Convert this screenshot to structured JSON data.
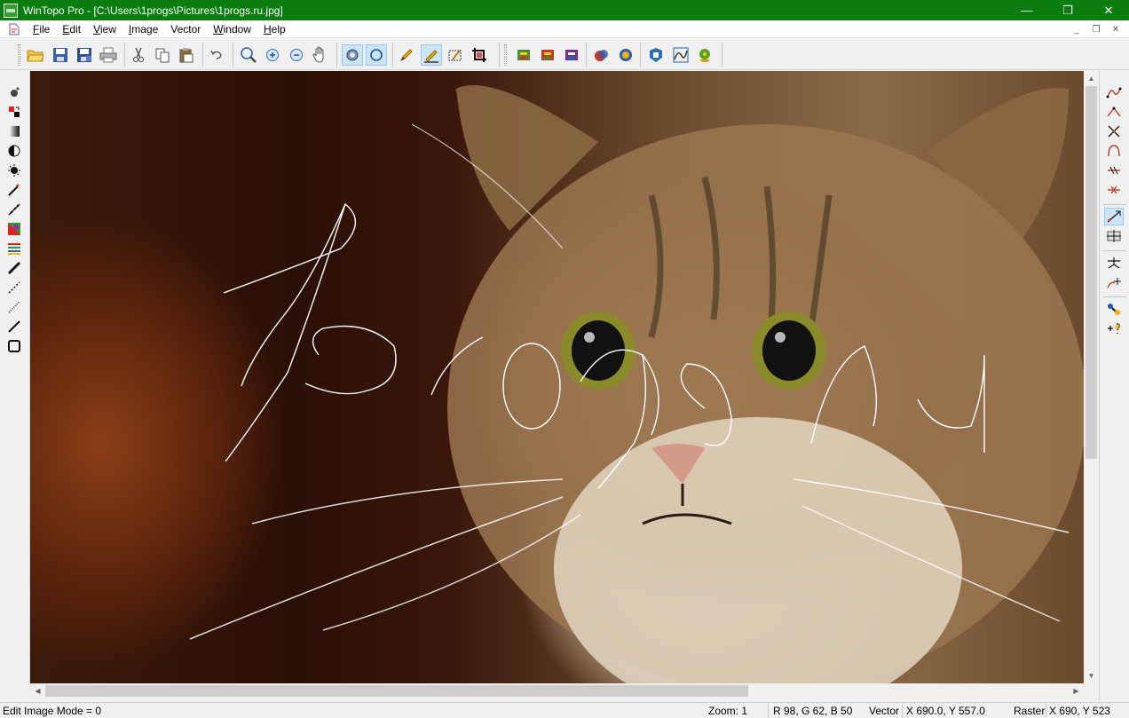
{
  "window": {
    "title": "WinTopo Pro - [C:\\Users\\1progs\\Pictures\\1progs.ru.jpg]",
    "minimize": "—",
    "restore": "❐",
    "close": "✕"
  },
  "menu": {
    "items": [
      {
        "accel": "F",
        "rest": "ile"
      },
      {
        "accel": "E",
        "rest": "dit"
      },
      {
        "accel": "V",
        "rest": "iew"
      },
      {
        "accel": "I",
        "rest": "mage"
      },
      {
        "accel": "",
        "rest": "Vector",
        "accel_after": "V",
        "label": "Vector"
      },
      {
        "accel": "W",
        "rest": "indow"
      },
      {
        "accel": "H",
        "rest": "elp"
      }
    ],
    "mdi_minimize": "_",
    "mdi_restore": "❐",
    "mdi_close": "✕"
  },
  "toolbar": {
    "icons": [
      "open-icon",
      "save-icon",
      "save-as-icon",
      "print-icon",
      "cut-icon",
      "copy-icon",
      "paste-icon",
      "undo-icon",
      "zoom-icon",
      "zoom-in-icon",
      "zoom-out-icon",
      "pan-hand-icon",
      "raster-view-icon",
      "vector-view-icon",
      "pencil-icon",
      "trace-line-icon",
      "crop-area-icon",
      "crop-icon",
      "layer-1-icon",
      "layer-2-icon",
      "layer-3-icon",
      "layer-4-icon",
      "layer-5-icon",
      "settings-icon",
      "batch-icon",
      "plugin-icon"
    ]
  },
  "status": {
    "mode": "Edit Image Mode = 0",
    "zoom": "Zoom: 1",
    "rgb": "R 98, G 62, B 50",
    "vector_label": "Vector",
    "vector_xy": "X 690.0, Y 557.0",
    "raster_label": "Raster",
    "raster_xy": "X 690, Y 523"
  },
  "colors": {
    "titlebar": "#0b7d10",
    "active_tool": "#cce4f7"
  }
}
